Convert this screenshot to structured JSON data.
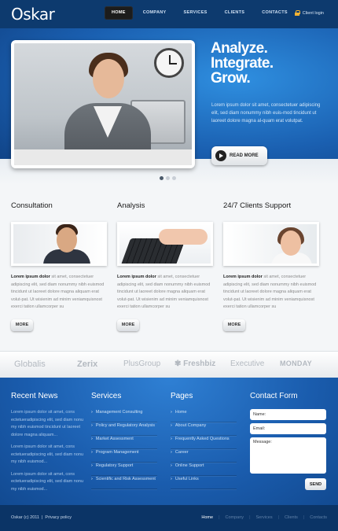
{
  "brand": {
    "logo": "Oskar"
  },
  "nav": {
    "items": [
      "HOME",
      "COMPANY",
      "SERVICES",
      "CLIENTS",
      "CONTACTS"
    ],
    "active": "HOME",
    "client_login": "Client login"
  },
  "hero": {
    "title_lines": [
      "Analyze.",
      "Integrate.",
      "Grow."
    ],
    "text": "Lorem ipsum dolor sit amet, consectetuer adipiscing elit, sed diam nonummy nibh euis-mod tincidunt ut laoreet dolore magna al-quam erat volutpat.",
    "button": "READ MORE",
    "slides": 3,
    "active_slide": 1
  },
  "features": [
    {
      "title": "Consultation",
      "lead": "Lorem ipsum dolor",
      "text": " sit amet, consectetuer adipiscing elit, sed diam nonummy nibh euismod tincidunt ut laoreet dolore magna aliquam erat volut-pat. Ut wisienim ad minim veniamquisnost exerci tation ullamcorper su",
      "button": "MORE"
    },
    {
      "title": "Analysis",
      "lead": "Lorem ipsum dolor",
      "text": " sit amet, consectetuer adipiscing elit, sed diam nonummy nibh euismod tincidunt ut laoreet dolore magna aliquam erat volut-pat. Ut wisienim ad minim veniamquisnost exerci tation ullamcorper su",
      "button": "MORE"
    },
    {
      "title": "24/7 Clients Support",
      "lead": "Lorem ipsum dolor",
      "text": " sit amet, consectetuer adipiscing elit, sed diam nonummy nibh euismod tincidunt ut laoreet dolore magna aliquam erat volut-pat. Ut wisienim ad minim veniamquisnost exerci tation ullamcorper su",
      "button": "MORE"
    }
  ],
  "partners": [
    "Globalis",
    "Zerix",
    "PlusGroup",
    "Freshbiz",
    "Executive",
    "MONDAY"
  ],
  "footer": {
    "news": {
      "title": "Recent News",
      "items": [
        "Lorem ipsum dolor sit amet, cons ectetueradipiscing elit, sed diam nonu my nibh euismod tincidunt ut laoreet dolore magna aliquam...",
        "Lorem ipsum dolor sit amet, cons ectetueradipiscing elit, sed diam nonu my nibh euismod...",
        "Lorem ipsum dolor sit amet, cons ectetueradipiscing elit, sed diam nonu my nibh euismod..."
      ]
    },
    "services": {
      "title": "Services",
      "items": [
        "Management Consulting",
        "Policy and Regulatory Analysis",
        "Market Assessment",
        "Program Management",
        "Regulatory Support",
        "Scientific and Risk Assessment"
      ]
    },
    "pages": {
      "title": "Pages",
      "items": [
        "Home",
        "About Company",
        "Frequently Asked Questions",
        "Career",
        "Online Support",
        "Useful Links"
      ]
    },
    "contact": {
      "title": "Contact Form",
      "name_placeholder": "Name:",
      "email_placeholder": "Email:",
      "message_placeholder": "Message:",
      "send": "SEND"
    }
  },
  "bottom": {
    "copyright": "Oskar (c) 2011",
    "separator": "|",
    "privacy": "Privacy policy",
    "nav": [
      "Home",
      "Company",
      "Services",
      "Clients",
      "Contacts"
    ],
    "active": "Home"
  }
}
